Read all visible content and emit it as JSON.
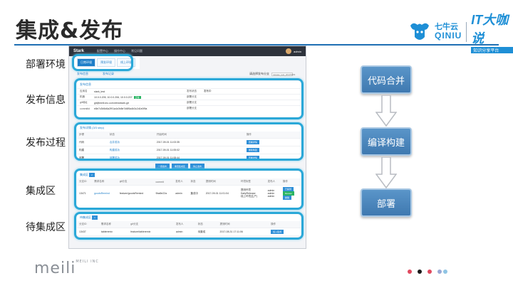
{
  "slide": {
    "title": "集成&发布",
    "labels": {
      "env": "部署环境",
      "info": "发布信息",
      "process": "发布过程",
      "integration": "集成区",
      "pending": "待集成区"
    }
  },
  "logos": {
    "qiniu_cn": "七牛云",
    "qiniu_en": "QINIU",
    "it_brand": "IT大咖说",
    "it_sub": "知识分享平台",
    "meili": "meili",
    "meili_sub": "MEILI INC"
  },
  "app": {
    "brand": "Stark",
    "nav": [
      "配置中心",
      "操作中心",
      "常见问题"
    ],
    "user": "admin",
    "env_tabs": [
      "日常环境",
      "预发环境",
      "线上环境"
    ],
    "sub_tabs": [
      "发布信息",
      "发布记录"
    ],
    "release_label": "请选择发布分支",
    "release_value": "release_test_20170901",
    "info": {
      "head": "发布信息",
      "rows": [
        {
          "k": "应用名",
          "v": "stark_test",
          "k2": "发布状态",
          "v2": "发布中"
        },
        {
          "k": "机器",
          "v": "10.0.0.205, 10.0.0.206, 10.0.0.207",
          "tag": "正常",
          "k2": "部署分支",
          "v2": ""
        },
        {
          "k": "git地址",
          "v": "git@meili-inc.com:infra/stark.git",
          "k2": "部署分支",
          "v2": ""
        },
        {
          "k": "commitid",
          "v": "e8e7c3b5d6a2f91a4c0b8e7d6f5a4b3c2d1e0f9a",
          "k2": "部署分支",
          "v2": ""
        }
      ]
    },
    "process": {
      "head": "发布详情 (3/3 step)",
      "columns": [
        "步骤",
        "状态",
        "开始时间",
        "操作"
      ],
      "rows": [
        {
          "step": "代码",
          "status": "合并成功",
          "time": "2017-09-01 11:03:35",
          "action": "查看详情"
        },
        {
          "step": "构建",
          "status": "构建成功",
          "time": "2017-09-01 11:05:02",
          "action": "重新构建"
        },
        {
          "step": "部署",
          "status": "部署成功",
          "time": "2017-09-01 11:08:44",
          "action": "查看详情"
        }
      ]
    },
    "actions": [
      "一键发布",
      "重置集成区",
      "停止发布"
    ],
    "integration": {
      "head": "集成区",
      "badge": "2",
      "columns": [
        "分支ID",
        "需求名称",
        "git分支",
        "commit",
        "发布人",
        "状态",
        "提测时间",
        "环境标签",
        "发布人",
        "操作"
      ],
      "row": {
        "id": "13471",
        "name": "goodsRemind",
        "branch": "feature/goodsRemind",
        "commit": "9ba8e22a",
        "owner": "admin",
        "status": "集成中",
        "time": "2017-09-01 11:01:04",
        "tag": "DailyRelease",
        "publisher": "admin"
      },
      "sub_rows": [
        {
          "tag": "提测环境",
          "who": "admin",
          "btn": "已提测"
        },
        {
          "tag": "预发环境",
          "who": "admin",
          "btn": "Review"
        },
        {
          "tag": "线上环境(生产)",
          "who": "admin",
          "btn": "撤销"
        }
      ]
    },
    "pending": {
      "head": "待集成区",
      "badge": "1",
      "columns": [
        "分支ID",
        "需求名称",
        "git分支",
        "发布人",
        "状态",
        "提测时间",
        "操作"
      ],
      "row": {
        "id": "13437",
        "name": "tableremix",
        "branch": "feature/tableremix",
        "owner": "admin",
        "status": "待集成",
        "time": "2017-08-31 17:11:06",
        "action": "加入集成"
      }
    }
  },
  "flow": {
    "steps": [
      "代码合并",
      "编译构建",
      "部署"
    ]
  },
  "colors": {
    "accent": "#1e6fb3",
    "highlight": "#2aa8d8",
    "flow_box": "#4a86bd",
    "dots": [
      "#e04a5f",
      "#1a1a1a",
      "#e04a5f",
      "#9aa9d6",
      "#8fc4e4"
    ]
  }
}
